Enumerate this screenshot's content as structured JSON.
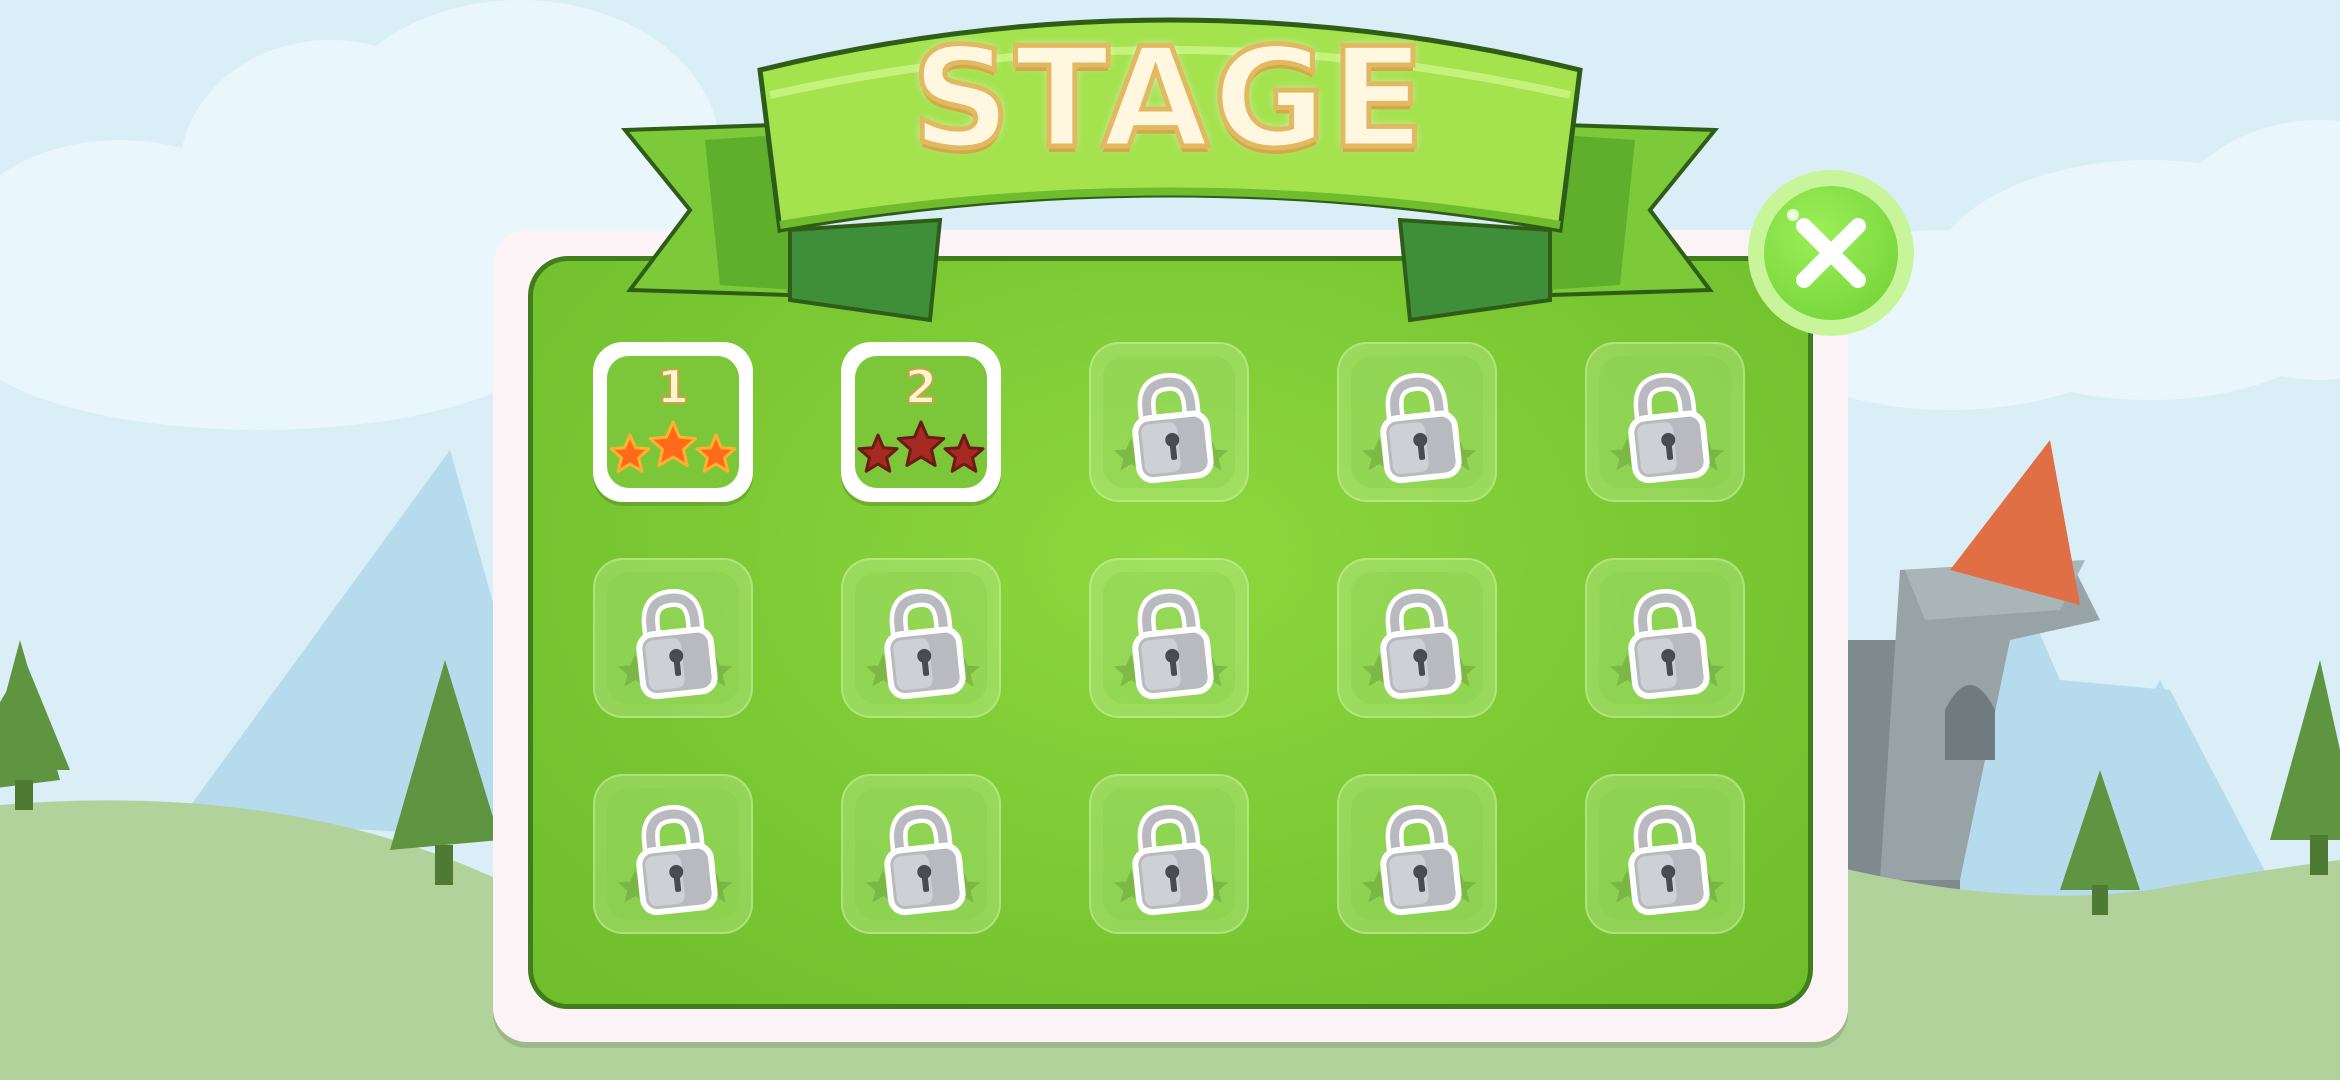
{
  "title": "STAGE",
  "close_icon": "close-x-icon",
  "colors": {
    "panel_green": "#7bc834",
    "banner_green": "#9be24c",
    "star_earned": "#ff6a1a",
    "star_empty": "#a52a22",
    "lock_gray": "#b9b9c0"
  },
  "stages": [
    {
      "label": "1",
      "locked": false,
      "stars": 3
    },
    {
      "label": "2",
      "locked": false,
      "stars": 0
    },
    {
      "label": "",
      "locked": true
    },
    {
      "label": "",
      "locked": true
    },
    {
      "label": "",
      "locked": true
    },
    {
      "label": "",
      "locked": true
    },
    {
      "label": "",
      "locked": true
    },
    {
      "label": "",
      "locked": true
    },
    {
      "label": "",
      "locked": true
    },
    {
      "label": "",
      "locked": true
    },
    {
      "label": "",
      "locked": true
    },
    {
      "label": "",
      "locked": true
    },
    {
      "label": "",
      "locked": true
    },
    {
      "label": "",
      "locked": true
    },
    {
      "label": "",
      "locked": true
    }
  ]
}
